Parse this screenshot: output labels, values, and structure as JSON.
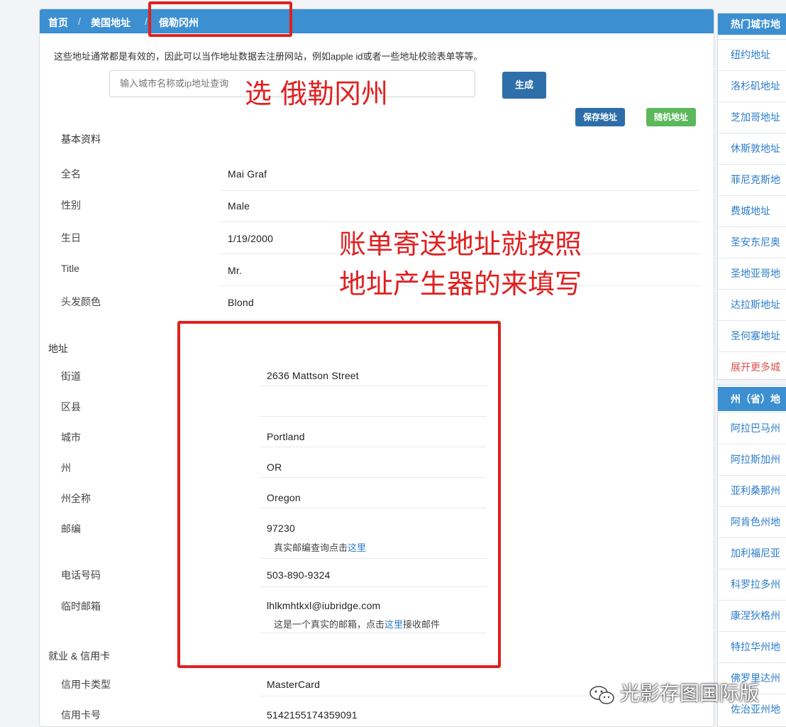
{
  "breadcrumb": {
    "home": "首页",
    "sep1": "/",
    "us_address": "美国地址",
    "sep2": "/",
    "current": "俄勒冈州"
  },
  "notice": "这些地址通常都是有效的，因此可以当作地址数据去注册网站，例如apple id或者一些地址校验表单等等。",
  "search": {
    "placeholder": "输入城市名称或ip地址查询"
  },
  "buttons": {
    "generate": "生成",
    "save": "保存地址",
    "random": "随机地址"
  },
  "basic": {
    "title": "基本资料",
    "rows": [
      {
        "label": "全名",
        "value": "Mai Graf"
      },
      {
        "label": "性别",
        "value": "Male"
      },
      {
        "label": "生日",
        "value": "1/19/2000"
      },
      {
        "label": "Title",
        "value": "Mr."
      },
      {
        "label": "头发颜色",
        "value": "Blond"
      }
    ]
  },
  "address": {
    "title": "地址",
    "rows": [
      {
        "label": "街道",
        "value": "2636  Mattson Street"
      },
      {
        "label": "区县",
        "value": ""
      },
      {
        "label": "城市",
        "value": "Portland"
      },
      {
        "label": "州",
        "value": "OR"
      },
      {
        "label": "州全称",
        "value": "Oregon"
      },
      {
        "label": "邮编",
        "value": "97230"
      },
      {
        "label": "电话号码",
        "value": "503-890-9324"
      },
      {
        "label": "临时邮箱",
        "value": "lhlkmhtkxl@iubridge.com"
      }
    ],
    "zip_note": {
      "prefix": "真实邮编查询点击",
      "link": "这里"
    },
    "email_note": {
      "prefix": "这是一个真实的邮箱，点击",
      "link": "这里",
      "suffix": "接收邮件"
    }
  },
  "employment": {
    "title": "就业 & 信用卡",
    "rows": [
      {
        "label": "信用卡类型",
        "value": "MasterCard"
      },
      {
        "label": "信用卡号",
        "value": "5142155174359091"
      }
    ]
  },
  "sidebar": {
    "hot_title": "热门城市地",
    "hot_items": [
      "纽约地址",
      "洛杉矶地址",
      "芝加哥地址",
      "休斯敦地址",
      "菲尼克斯地",
      "费城地址",
      "圣安东尼奥",
      "圣地亚哥地",
      "达拉斯地址",
      "圣何塞地址"
    ],
    "hot_more": "展开更多城",
    "state_title": "州（省）地",
    "state_items": [
      "阿拉巴马州",
      "阿拉斯加州",
      "亚利桑那州",
      "阿肯色州地",
      "加利福尼亚",
      "科罗拉多州",
      "康涅狄格州",
      "特拉华州地",
      "佛罗里达州",
      "佐治亚州地"
    ]
  },
  "annotations": {
    "select": "选 俄勒冈州",
    "billing_line1": "账单寄送地址就按照",
    "billing_line2": "地址产生器的来填写"
  },
  "watermark": "光影存图国际版",
  "colors": {
    "header": "#3c8fd0",
    "primary_button": "#2f6fa9",
    "success_button": "#5cb85c",
    "annotation": "#e02020",
    "link": "#2a7bc8"
  }
}
